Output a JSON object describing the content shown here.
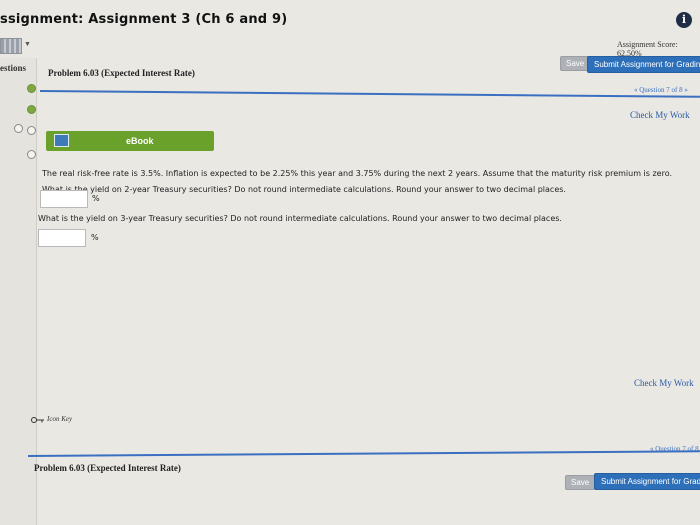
{
  "header": {
    "title": "ssignment: Assignment 3 (Ch 6 and 9)",
    "info_icon": "i",
    "assignment_score": "Assignment Score: 62.50%"
  },
  "toolbar": {
    "save_label": "Save",
    "submit_label": "Submit Assignment for Grading"
  },
  "sidebar": {
    "questions_label": "estions",
    "items": [
      {
        "status": "done"
      },
      {
        "status": "done"
      },
      {
        "status": "open"
      },
      {
        "status": "open"
      },
      {
        "status": "open"
      }
    ]
  },
  "problem": {
    "title": "Problem 6.03 (Expected Interest Rate)",
    "question_nav": "« Question 7 of 8 »",
    "check_work": "Check My Work",
    "ebook_label": "eBook",
    "statement": "The real risk-free rate is 3.5%. Inflation is expected to be 2.25% this year and 3.75% during the next 2 years. Assume that the maturity risk premium is zero.",
    "q1": "What is the yield on 2-year Treasury securities? Do not round intermediate calculations. Round your answer to two decimal places.",
    "q1_unit": "%",
    "q1_value": "",
    "q2": "What is the yield on 3-year Treasury securities? Do not round intermediate calculations. Round your answer to two decimal places.",
    "q2_unit": "%",
    "q2_value": ""
  },
  "footer": {
    "check_work": "Check My Work",
    "icon_key": "Icon Key",
    "problem_title": "Problem 6.03 (Expected Interest Rate)",
    "question_nav": "« Question 7 of 8",
    "save_label": "Save",
    "submit_label": "Submit Assignment for Gradin"
  },
  "colors": {
    "accent_blue": "#2d6fb8",
    "ebook_green": "#6aa12a",
    "done_green": "#7fa844"
  }
}
